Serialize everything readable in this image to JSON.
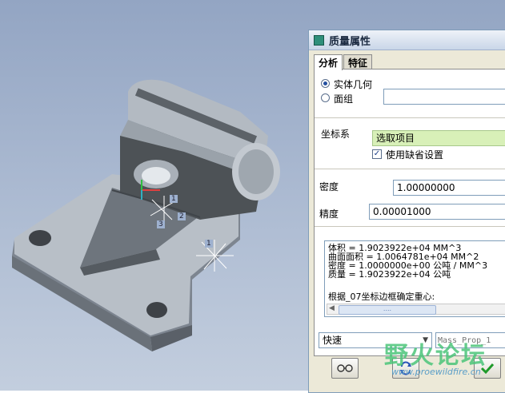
{
  "dialog": {
    "title": "质量属性",
    "tabs": [
      {
        "label": "分析"
      },
      {
        "label": "特征"
      }
    ],
    "geometry": {
      "option_solid": "实体几何",
      "option_quilt": "面组",
      "quilt_value": ""
    },
    "coordinate_system": {
      "label": "坐标系",
      "select_value": "选取项目",
      "use_default_label": "使用缺省设置",
      "use_default_checked": true
    },
    "density": {
      "label": "密度",
      "value": "1.00000000"
    },
    "accuracy": {
      "label": "精度",
      "value": "0.00001000"
    },
    "results": {
      "lines": [
        "体积 =  1.9023922e+04  MM^3",
        "曲面面积 =  1.0064781e+04  MM^2",
        "密度 =  1.0000000e+00 公吨 / MM^3",
        "质量 =  1.9023922e+04 公吨"
      ],
      "note": "根据_07坐标边框确定重心:"
    },
    "scroll_thumb": "....",
    "mode_select": "快速",
    "name_placeholder": "Mass_Prop_1",
    "buttons": {
      "preview_icon": "glasses-icon",
      "repeat_icon": "refresh-icon",
      "ok_icon": "checkmark-icon"
    }
  },
  "viewport": {
    "csys_labels": [
      "1",
      "2",
      "3"
    ],
    "point_label": "1"
  },
  "watermark": {
    "text": "野火论坛",
    "url": "www.proewildfire.cn"
  },
  "colors": {
    "part_face": "#b9c0c8",
    "part_dark": "#4d5256",
    "accent_green": "#d8f0b8"
  }
}
